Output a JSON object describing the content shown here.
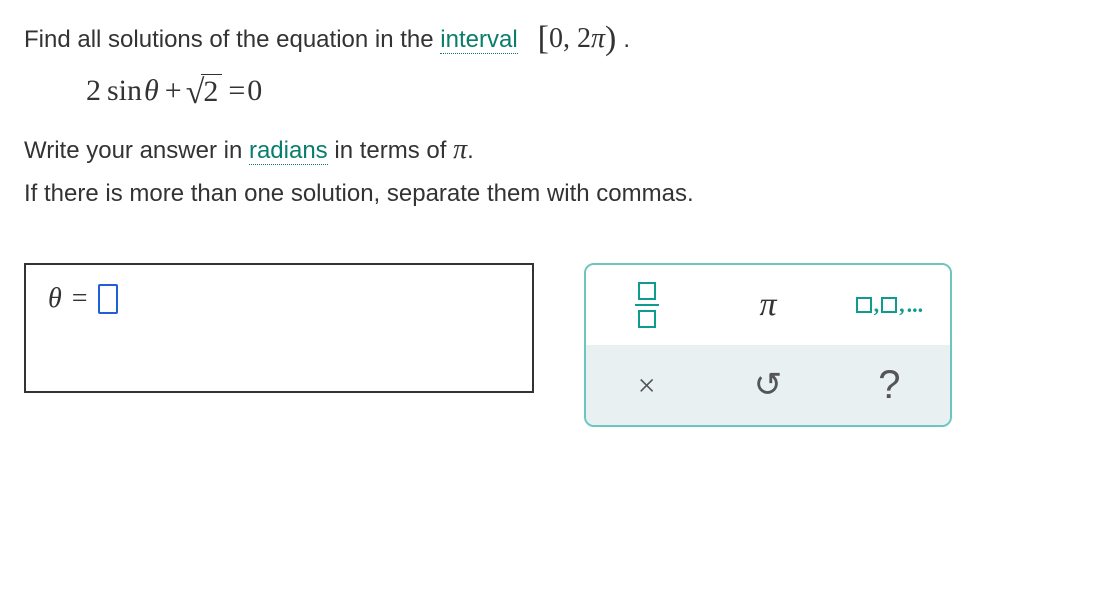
{
  "text": {
    "pre_interval": "Find all solutions of the equation in the ",
    "interval_term": "interval",
    "interval_expr_open": "[",
    "interval_expr_zero": "0, 2",
    "interval_expr_pi": "π",
    "interval_expr_close": ")",
    "period": ".",
    "instr1_pre": "Write your answer in ",
    "radians_term": "radians",
    "instr1_post": " in terms of ",
    "pi_char": "π",
    "instr2": "If there is more than one solution, separate them with commas."
  },
  "equation": {
    "coef1": "2",
    "sin": "sin",
    "theta1": "θ",
    "plus": "+",
    "radicand": "2",
    "eq": "=",
    "rhs": "0"
  },
  "answer": {
    "theta": "θ",
    "eq": "="
  },
  "tools": {
    "pi": "π",
    "list_sep": ",",
    "list_ellipsis": "...",
    "clear": "×",
    "undo": "↺",
    "help": "?"
  }
}
